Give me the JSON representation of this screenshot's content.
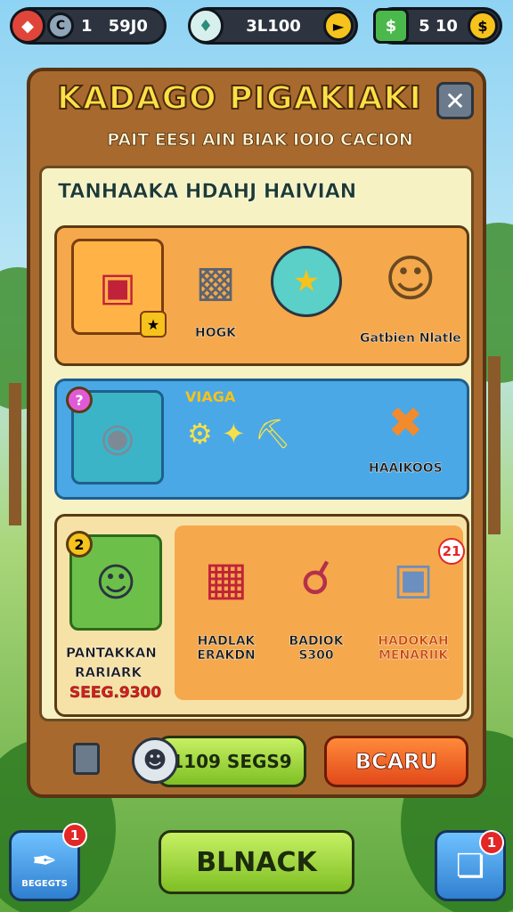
{
  "hud": {
    "left_value": "1",
    "left_amount": "59J0",
    "mid_value": "3L100",
    "right_value": "5 10"
  },
  "dialog": {
    "title": "KADAGO PIGAKIAKI",
    "subtitle": "PAIT EESI AIN BIAK IOIO CACION",
    "section_title": "TANHAAKA HDAHJ HAIVIAN"
  },
  "card1": {
    "items": [
      {
        "label": ""
      },
      {
        "label": "HOGK"
      },
      {
        "label": ""
      },
      {
        "label": "Gatbien Nlatle"
      }
    ]
  },
  "card2": {
    "badge": "?",
    "header": "VIAGA",
    "item_label": "HAAIKOOS"
  },
  "card3": {
    "badge": "2",
    "lead_label_1": "PANTAKKAN",
    "lead_label_2": "RARIARK",
    "price": "SEEG.9300",
    "items": [
      {
        "label_1": "HADLAK",
        "label_2": "ERAKDN"
      },
      {
        "label_1": "BADIOK",
        "label_2": "S300"
      },
      {
        "label_1": "HADOKAH",
        "label_2": "MENARIIK"
      }
    ],
    "corner_badge": "21"
  },
  "footer": {
    "timer_label": "1109 SEGS9",
    "action_label": "BCARU"
  },
  "bottom": {
    "main_button": "BLNACK",
    "left_button_label": "BEGEGTS",
    "left_notif": "1",
    "right_notif": "1"
  }
}
